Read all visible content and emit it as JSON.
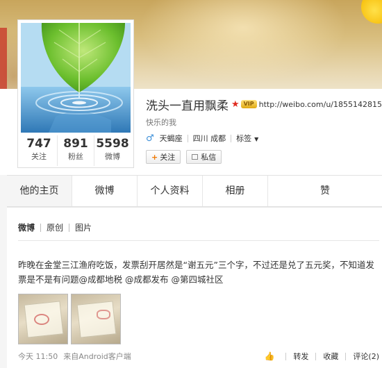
{
  "profile": {
    "name": "洗头一直用飘柔",
    "vip_label": "VIP",
    "url": "http://weibo.com/u/1855142815",
    "bio": "快乐的我",
    "gender_icon": "♂",
    "zodiac": "天蝎座",
    "location": "四川 成都",
    "tags_label": "标签",
    "follow_label": "关注",
    "message_label": "私信",
    "stats": [
      {
        "num": "747",
        "label": "关注"
      },
      {
        "num": "891",
        "label": "粉丝"
      },
      {
        "num": "5598",
        "label": "微博"
      }
    ]
  },
  "tabs": [
    "他的主页",
    "微博",
    "个人资料",
    "相册",
    "赞"
  ],
  "subnav": [
    "微博",
    "原创",
    "图片"
  ],
  "post": {
    "text": "昨晚在金堂三江渔府吃饭，发票刮开居然是“谢五元”三个字，不过还是兑了五元奖，不知道发票是不是有问题@成都地税 @成都发布 @第四城社区",
    "time": "今天 11:50",
    "source": "来自Android客户端",
    "actions": {
      "forward": "转发",
      "favorite": "收藏",
      "comment": "评论(2)"
    }
  },
  "colors": {
    "accent": "#f07800",
    "star": "#e02b20",
    "link": "#3b8ed8"
  }
}
